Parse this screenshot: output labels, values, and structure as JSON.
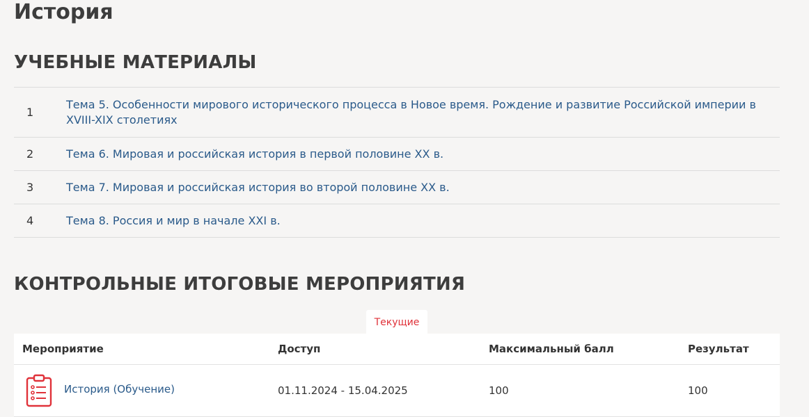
{
  "page": {
    "title": "История"
  },
  "materials": {
    "title": "УЧЕБНЫЕ МАТЕРИАЛЫ",
    "items": [
      {
        "num": "1",
        "label": "Тема 5. Особенности мирового исторического процесса в Новое время. Рождение и развитие Российской империи в XVIII-XIX столетиях"
      },
      {
        "num": "2",
        "label": "Тема 6. Мировая и российская история в первой половине XX в."
      },
      {
        "num": "3",
        "label": "Тема 7. Мировая и российская история во второй половине XX в."
      },
      {
        "num": "4",
        "label": "Тема 8. Россия и мир в начале XXI в."
      }
    ]
  },
  "events": {
    "title": "КОНТРОЛЬНЫЕ ИТОГОВЫЕ МЕРОПРИЯТИЯ",
    "tab_label": "Текущие",
    "columns": {
      "event": "Мероприятие",
      "access": "Доступ",
      "max_score": "Максимальный балл",
      "result": "Результат"
    },
    "rows": [
      {
        "icon": "checklist-icon",
        "name": "История (Обучение)",
        "access": "01.11.2024 - 15.04.2025",
        "max_score": "100",
        "result": "100"
      }
    ]
  },
  "colors": {
    "link": "#2a5a8a",
    "accent": "#e0323a",
    "background": "#f6f5f4"
  }
}
